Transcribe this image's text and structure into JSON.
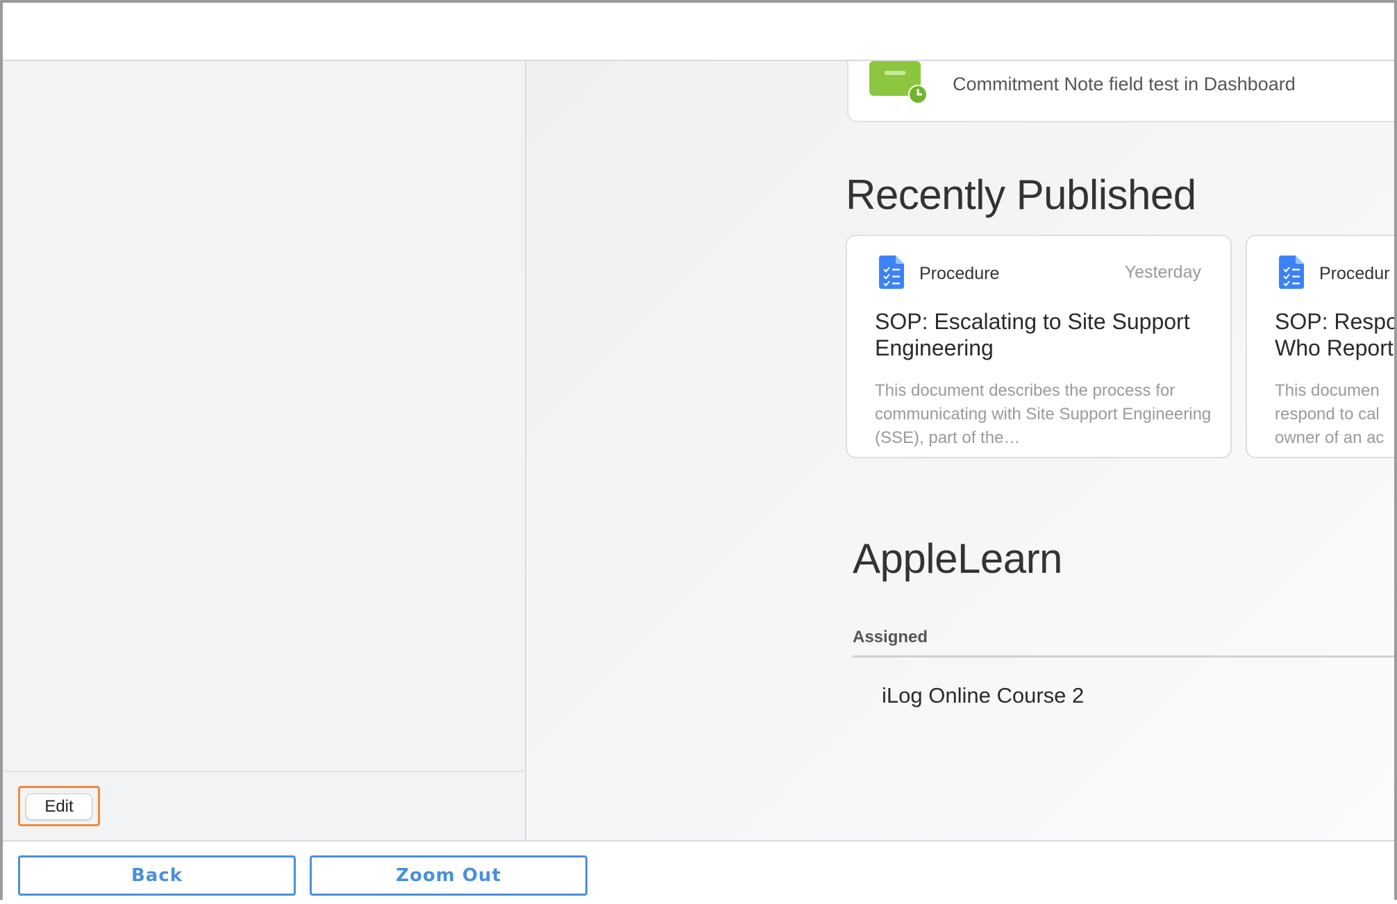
{
  "top_card": {
    "text": "Commitment Note field test in Dashboard"
  },
  "recently_published": {
    "title": "Recently Published",
    "cards": [
      {
        "type": "Procedure",
        "date": "Yesterday",
        "title": "SOP: Escalating to Site Support Engineering",
        "description": "This document describes the process for communicating with Site Support Engineering (SSE), part of the…"
      },
      {
        "type": "Procedur",
        "title": "SOP: Respo\nWho Report",
        "description": "This documen\nrespond to cal\nowner of an ac"
      }
    ]
  },
  "applelearn": {
    "title": "AppleLearn",
    "assigned_label": "Assigned",
    "courses": [
      "iLog Online Course 2"
    ]
  },
  "sidebar": {
    "edit_label": "Edit"
  },
  "bottom_bar": {
    "back_label": "Back",
    "zoom_out_label": "Zoom Out"
  },
  "colors": {
    "highlight": "#ef8a3c",
    "nav_button": "#4a90d9",
    "commitment_icon": "#8cc63f",
    "doc_icon": "#3b82f6"
  },
  "icons": {
    "commitment": "commitment-note-icon",
    "document": "procedure-document-icon"
  }
}
